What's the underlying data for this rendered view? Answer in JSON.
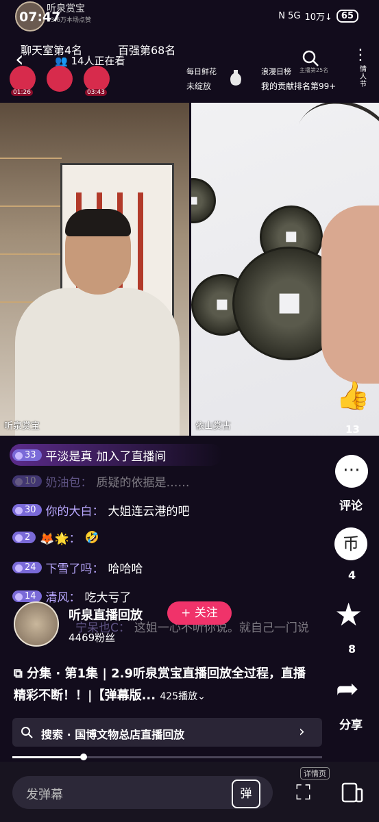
{
  "status_bar": {
    "time": "07:47",
    "network": "N 5G",
    "speed": "10万↓",
    "battery": "65"
  },
  "top": {
    "streamer_name": "听泉赏宝",
    "streamer_sub": "83.6万本场点赞",
    "chat_rank": "聊天室第4名",
    "top100_rank": "百强第68名",
    "watching": "14人正在看",
    "flower_label": "每日鲜花",
    "flower_status": "未绽放",
    "daily_list": "浪漫日榜",
    "daily_sub": "主播第25名",
    "contribution_rank": "我的贡献排名第99+",
    "more_label": "情人节",
    "badges": [
      "01:26",
      "",
      "03:43"
    ]
  },
  "video": {
    "left_label": "听泉赏宝",
    "right_label": "依山赏古"
  },
  "actions": {
    "likes": "13",
    "comment_label": "评论",
    "coins": "4",
    "favorites": "8",
    "share_label": "分享"
  },
  "comments": [
    {
      "level": "33",
      "user": "平淡是真",
      "text": "加入了直播间"
    },
    {
      "level": "10",
      "user": "奶油包：",
      "text": "质疑的依据是……"
    },
    {
      "level": "30",
      "user": "你的大白：",
      "text": "大姐连云港的吧"
    },
    {
      "level": "2",
      "user": "🦊🌟：",
      "text": "🤣"
    },
    {
      "level": "24",
      "user": "下雪了吗：",
      "text": "哈哈哈"
    },
    {
      "level": "14",
      "user": "清风：",
      "text": "吃大亏了"
    },
    {
      "level": "",
      "user": "宁呆也C：",
      "text": "这姐一心不听你说。就自己一门说"
    }
  ],
  "author": {
    "name": "听泉直播回放",
    "follow_label": "+ 关注",
    "fans": "4469粉丝"
  },
  "description": {
    "series": "分集 · 第1集",
    "title": "2.9听泉赏宝直播回放全过程，直播精彩不断！！|【弹幕版...",
    "plays": "425播放"
  },
  "search": {
    "text": "搜索 · 国博文物总店直播回放"
  },
  "progress": 0.23,
  "bottom": {
    "danmaku_placeholder": "发弹幕",
    "danmaku_toggle": "弹",
    "detail_label": "详情页"
  }
}
